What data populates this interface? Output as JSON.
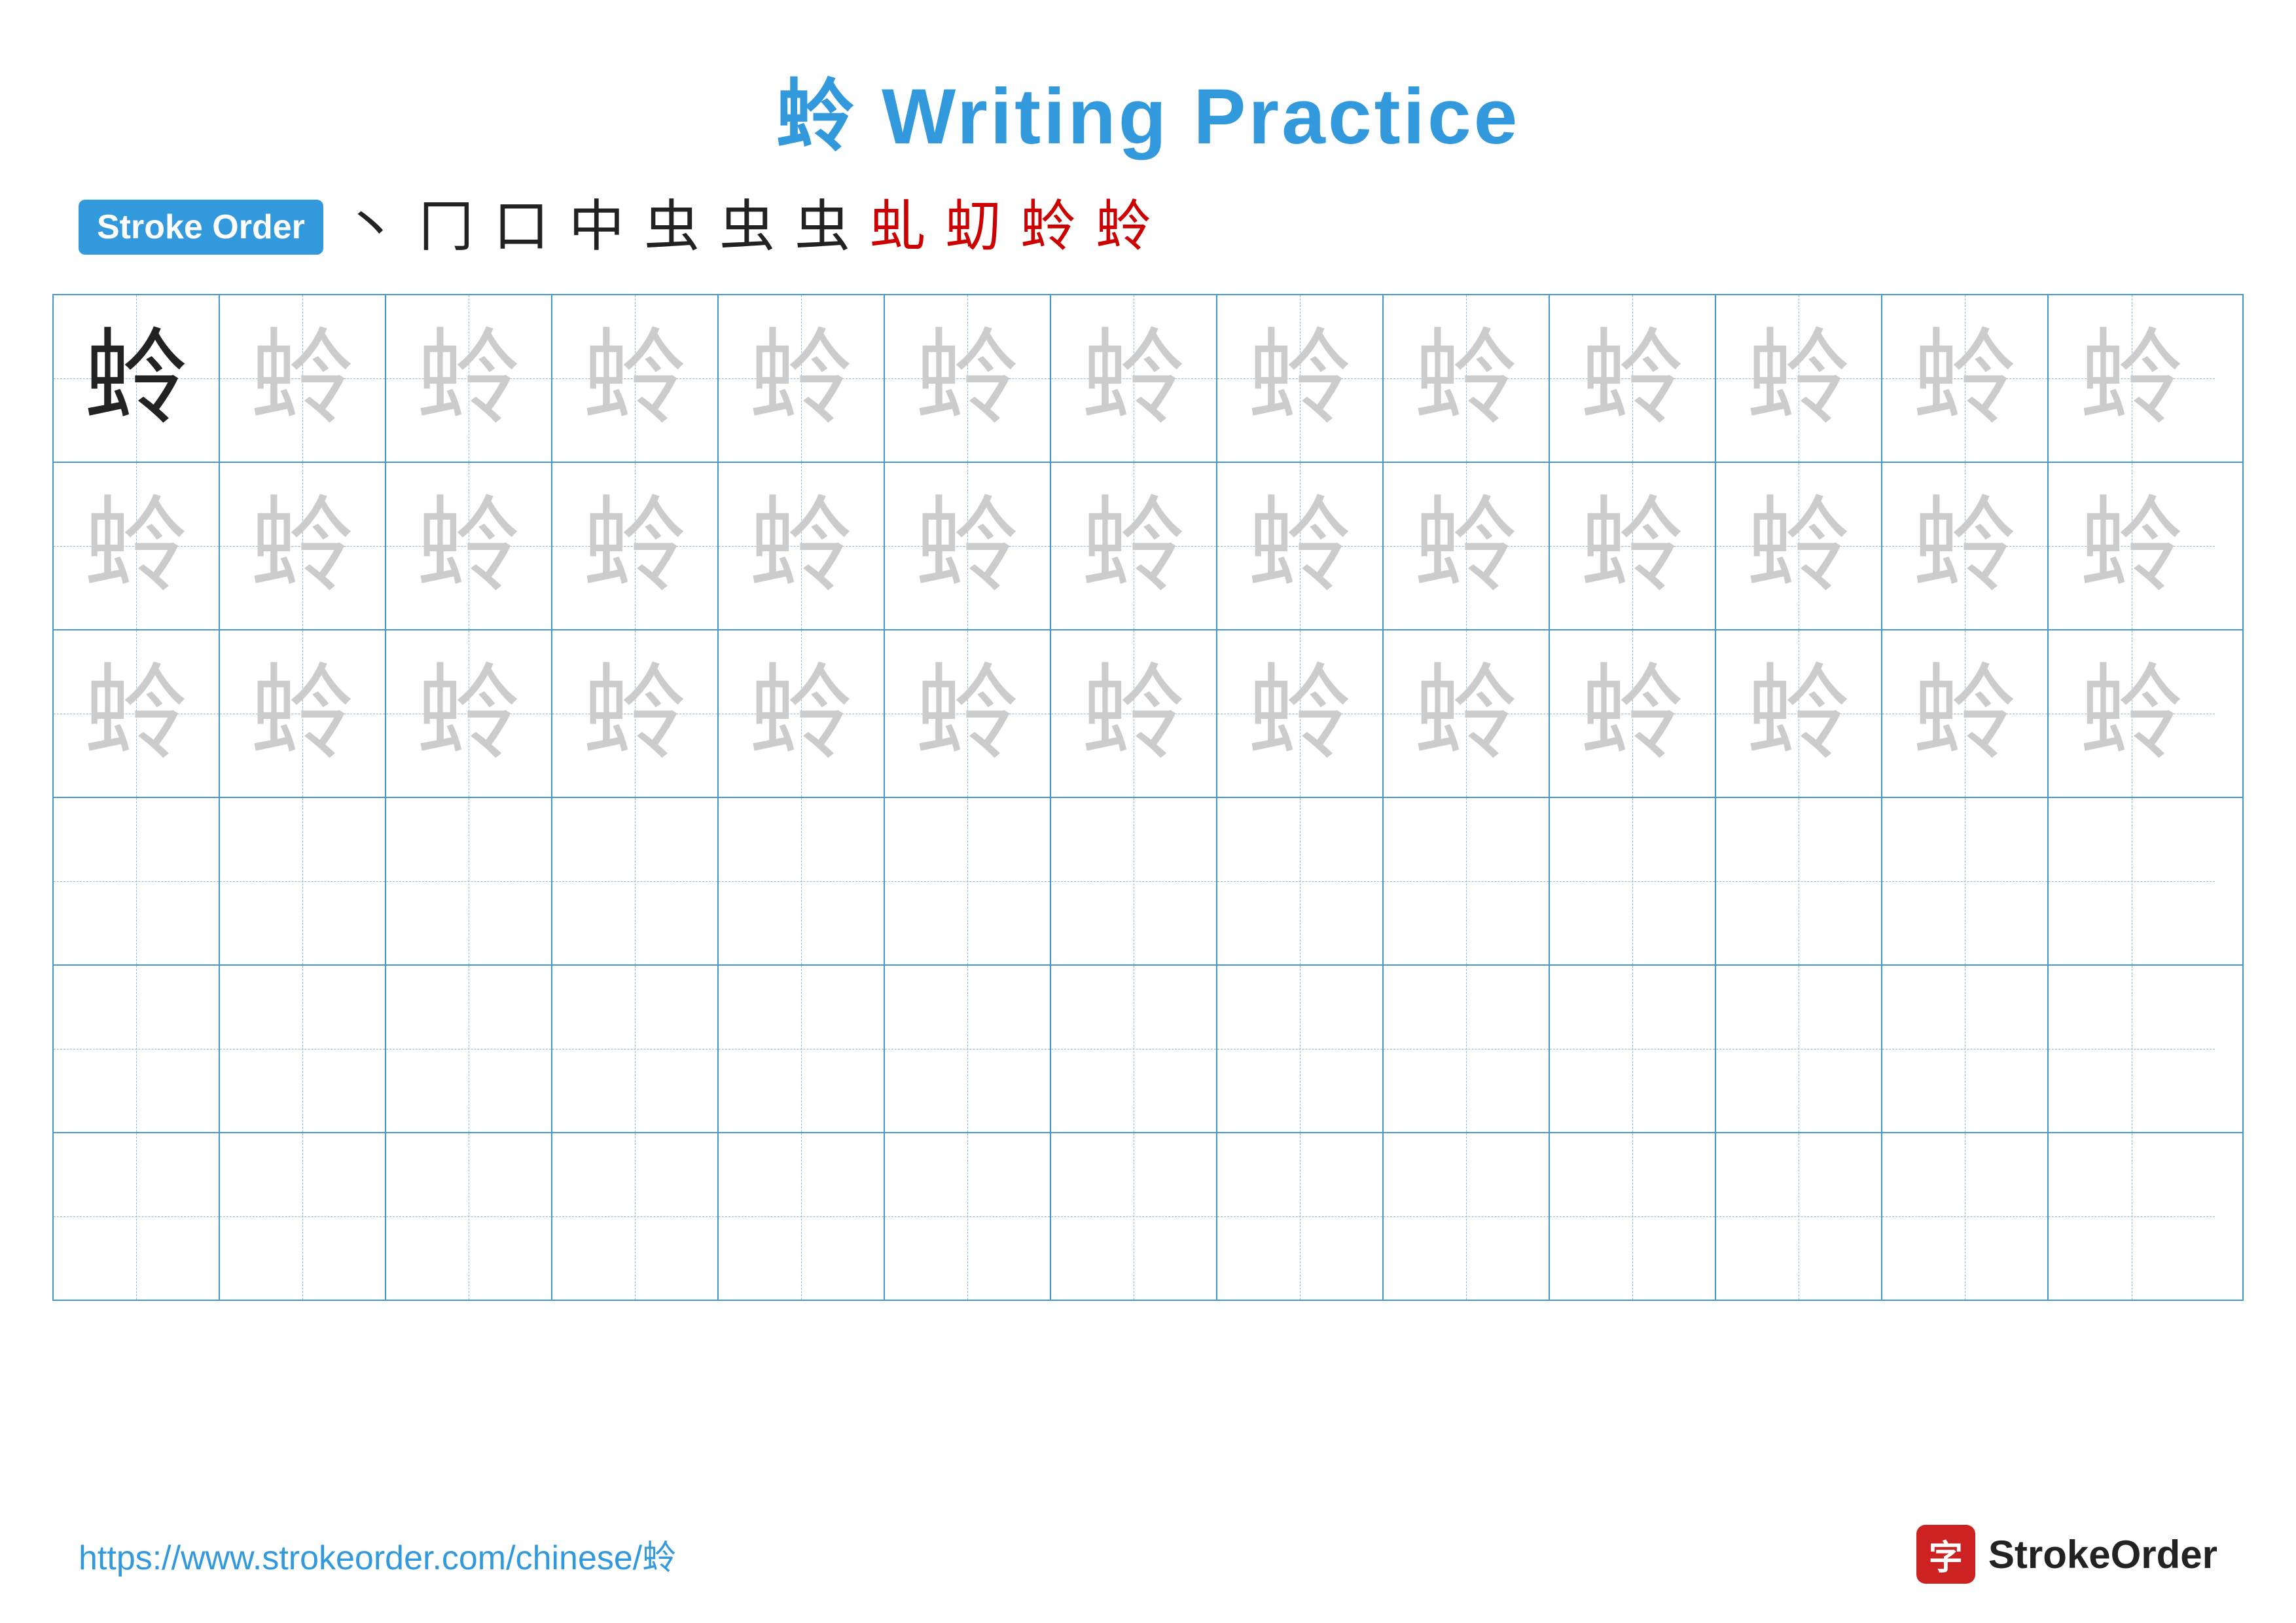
{
  "title": {
    "char": "蛉",
    "text": " Writing Practice",
    "full": "蛉 Writing Practice"
  },
  "strokeOrder": {
    "badge": "Stroke Order",
    "strokes": [
      "丶",
      "冂",
      "口",
      "中",
      "虫",
      "虫",
      "虫/",
      "虬",
      "虭",
      "蛉",
      "蛉"
    ]
  },
  "grid": {
    "rows": 6,
    "cols": 13,
    "char": "蛉",
    "ghostRows": [
      1,
      2,
      3
    ],
    "solidCell": {
      "row": 0,
      "col": 0
    }
  },
  "footer": {
    "url": "https://www.strokeorder.com/chinese/蛉",
    "logoText": "StrokeOrder",
    "logoChar": "字"
  }
}
